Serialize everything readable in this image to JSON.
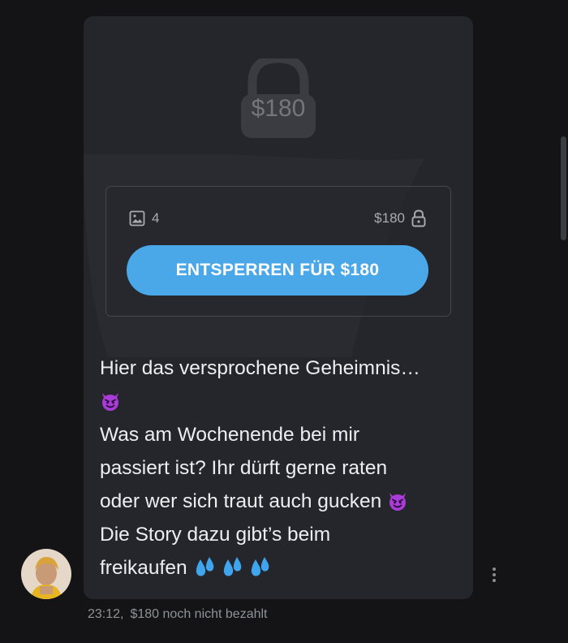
{
  "locked_post": {
    "lock_price": "$180",
    "media_count": "4",
    "media_price": "$180",
    "unlock_label": "ENTSPERREN FÜR $180"
  },
  "message": {
    "lines": [
      "Hier das versprochene Geheimnis…",
      "Was am Wochenende bei mir",
      "passiert ist? Ihr dürft gerne raten",
      "oder wer sich traut auch gucken",
      "Die Story dazu gibt’s beim",
      "freikaufen"
    ],
    "emojis": {
      "devil": "smiling-face-with-horns-icon",
      "drops": "sweat-droplets-icon"
    }
  },
  "meta": {
    "time": "23:12,",
    "payment_status": "$180 noch nicht bezahlt"
  },
  "colors": {
    "background": "#141416",
    "bubble": "#24262b",
    "accent_button": "#4aa7e8",
    "devil_emoji": "#a93bd6",
    "drops_emoji": "#3fa5ec"
  }
}
